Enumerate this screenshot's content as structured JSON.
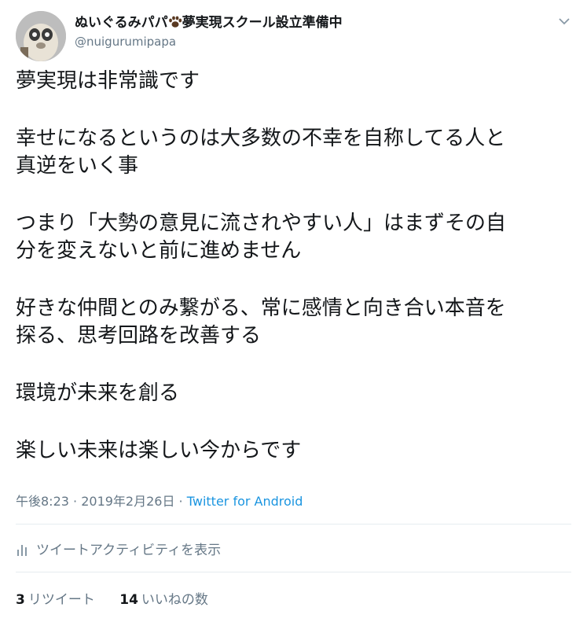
{
  "author": {
    "display_name": "ぬいぐるみパパ🐾夢実現スクール設立準備中",
    "display_name_text": "ぬいぐるみパパ",
    "display_name_suffix": "夢実現スクール設立準備中",
    "handle": "@nuigurumipapa",
    "avatar_icon": "plush-toy-avatar"
  },
  "tweet": {
    "paragraphs": [
      [
        "夢実現は非常識です"
      ],
      [
        "幸せになるというのは大多数の不幸を自称してる人と",
        "真逆をいく事"
      ],
      [
        "つまり「大勢の意見に流されやすい人」はまずその自",
        "分を変えないと前に進めません"
      ],
      [
        "好きな仲間とのみ繋がる、常に感情と向き合い本音を",
        "探る、思考回路を改善する"
      ],
      [
        "環境が未来を創る"
      ],
      [
        "楽しい未来は楽しい今からです"
      ]
    ]
  },
  "meta": {
    "time": "午後8:23",
    "separator": " · ",
    "date": "2019年2月26日",
    "source": "Twitter for Android"
  },
  "activity": {
    "label": "ツイートアクティビティを表示",
    "icon": "bar-chart-icon"
  },
  "stats": {
    "retweets_count": "3",
    "retweets_label": "リツイート",
    "likes_count": "14",
    "likes_label": "いいねの数"
  },
  "colors": {
    "text": "#14171a",
    "secondary": "#657786",
    "link": "#1b95e0",
    "divider": "#e6ecf0"
  }
}
